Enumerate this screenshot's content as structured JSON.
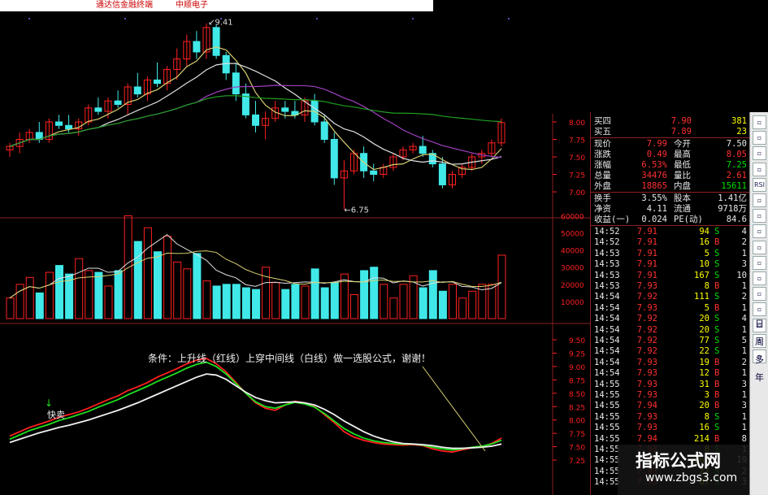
{
  "window": {
    "title_left": "通达信金融终端",
    "title_right": "中顺电子"
  },
  "chart_data": [
    {
      "type": "candlestick",
      "axis_ticks": [
        "8.00",
        "7.75",
        "7.50",
        "7.25",
        "7.00"
      ],
      "annotations": {
        "high": "9.41",
        "low": "6.75"
      },
      "candles": [
        [
          7.6,
          7.7,
          7.5,
          7.65
        ],
        [
          7.65,
          7.85,
          7.55,
          7.75
        ],
        [
          7.75,
          7.9,
          7.7,
          7.85
        ],
        [
          7.85,
          8.0,
          7.7,
          7.75
        ],
        [
          7.75,
          8.05,
          7.7,
          8.0
        ],
        [
          8.0,
          8.1,
          7.9,
          7.95
        ],
        [
          7.95,
          8.1,
          7.85,
          7.9
        ],
        [
          7.9,
          8.05,
          7.8,
          8.0
        ],
        [
          8.0,
          8.25,
          7.95,
          8.2
        ],
        [
          8.2,
          8.35,
          8.1,
          8.15
        ],
        [
          8.15,
          8.35,
          8.05,
          8.3
        ],
        [
          8.3,
          8.45,
          8.2,
          8.25
        ],
        [
          8.25,
          8.55,
          8.1,
          8.5
        ],
        [
          8.5,
          8.7,
          8.35,
          8.4
        ],
        [
          8.4,
          8.65,
          8.3,
          8.6
        ],
        [
          8.6,
          8.85,
          8.5,
          8.55
        ],
        [
          8.55,
          8.8,
          8.45,
          8.75
        ],
        [
          8.75,
          9.05,
          8.6,
          8.9
        ],
        [
          8.9,
          9.25,
          8.8,
          9.15
        ],
        [
          9.15,
          9.3,
          8.9,
          9.0
        ],
        [
          9.0,
          9.41,
          8.9,
          9.35
        ],
        [
          9.35,
          9.4,
          8.9,
          8.95
        ],
        [
          8.95,
          9.0,
          8.6,
          8.7
        ],
        [
          8.7,
          8.85,
          8.3,
          8.4
        ],
        [
          8.4,
          8.55,
          8.05,
          8.1
        ],
        [
          8.1,
          8.3,
          7.85,
          7.95
        ],
        [
          7.95,
          8.15,
          7.75,
          8.05
        ],
        [
          8.05,
          8.3,
          8.0,
          8.2
        ],
        [
          8.2,
          8.3,
          8.05,
          8.15
        ],
        [
          8.15,
          8.3,
          8.05,
          8.1
        ],
        [
          8.1,
          8.35,
          8.0,
          8.3
        ],
        [
          8.3,
          8.4,
          7.95,
          8.0
        ],
        [
          8.0,
          8.1,
          7.7,
          7.75
        ],
        [
          7.75,
          7.85,
          7.1,
          7.2
        ],
        [
          7.2,
          7.45,
          6.75,
          7.3
        ],
        [
          7.3,
          7.6,
          7.25,
          7.55
        ],
        [
          7.55,
          7.65,
          7.2,
          7.3
        ],
        [
          7.3,
          7.4,
          7.15,
          7.25
        ],
        [
          7.25,
          7.4,
          7.2,
          7.35
        ],
        [
          7.35,
          7.55,
          7.3,
          7.5
        ],
        [
          7.5,
          7.65,
          7.45,
          7.6
        ],
        [
          7.6,
          7.7,
          7.55,
          7.65
        ],
        [
          7.65,
          7.8,
          7.5,
          7.55
        ],
        [
          7.55,
          7.6,
          7.35,
          7.4
        ],
        [
          7.4,
          7.5,
          7.05,
          7.1
        ],
        [
          7.1,
          7.3,
          7.05,
          7.25
        ],
        [
          7.25,
          7.4,
          7.2,
          7.35
        ],
        [
          7.35,
          7.55,
          7.3,
          7.5
        ],
        [
          7.5,
          7.6,
          7.4,
          7.55
        ],
        [
          7.55,
          7.75,
          7.5,
          7.7
        ],
        [
          7.7,
          8.05,
          7.65,
          7.99
        ]
      ]
    },
    {
      "type": "bar",
      "axis_ticks": [
        "60000",
        "50000",
        "40000",
        "30000",
        "20000",
        "10000"
      ],
      "values": [
        12000,
        20000,
        24000,
        15000,
        27000,
        31000,
        26000,
        35000,
        28000,
        27000,
        19000,
        28000,
        60000,
        45000,
        53000,
        39000,
        48000,
        33000,
        29000,
        38000,
        22000,
        19000,
        20000,
        20000,
        18000,
        17000,
        30000,
        21000,
        17000,
        20000,
        19000,
        29000,
        18000,
        21000,
        26000,
        14000,
        28000,
        30000,
        20000,
        12000,
        20000,
        25000,
        18000,
        28000,
        16000,
        20000,
        12000,
        16000,
        20000,
        20000,
        37000
      ]
    },
    {
      "type": "line",
      "axis_ticks": [
        "9.50",
        "9.25",
        "9.00",
        "8.75",
        "8.50",
        "8.25",
        "8.00",
        "7.75",
        "7.50",
        "7.25"
      ],
      "series": [
        {
          "name": "",
          "color": "#ff2020",
          "values": [
            7.7,
            7.78,
            7.86,
            7.92,
            7.98,
            8.05,
            8.1,
            8.15,
            8.22,
            8.3,
            8.38,
            8.45,
            8.55,
            8.62,
            8.7,
            8.8,
            8.88,
            8.96,
            9.05,
            9.12,
            9.15,
            9.05,
            8.9,
            8.7,
            8.5,
            8.32,
            8.22,
            8.18,
            8.28,
            8.35,
            8.32,
            8.25,
            8.1,
            7.95,
            7.78,
            7.68,
            7.62,
            7.58,
            7.55,
            7.54,
            7.53,
            7.54,
            7.52,
            7.46,
            7.42,
            7.4,
            7.44,
            7.48,
            7.5,
            7.56,
            7.66
          ]
        },
        {
          "name": "",
          "color": "#20e020",
          "values": [
            7.64,
            7.72,
            7.8,
            7.86,
            7.92,
            7.99,
            8.04,
            8.1,
            8.16,
            8.24,
            8.31,
            8.38,
            8.47,
            8.55,
            8.63,
            8.72,
            8.8,
            8.88,
            8.97,
            9.04,
            9.08,
            9.0,
            8.86,
            8.68,
            8.5,
            8.34,
            8.25,
            8.22,
            8.28,
            8.33,
            8.3,
            8.24,
            8.12,
            7.98,
            7.84,
            7.74,
            7.66,
            7.61,
            7.58,
            7.56,
            7.55,
            7.55,
            7.53,
            7.49,
            7.46,
            7.44,
            7.46,
            7.49,
            7.51,
            7.55,
            7.62
          ]
        },
        {
          "name": "",
          "color": "#f0f0f0",
          "values": [
            7.58,
            7.64,
            7.7,
            7.76,
            7.81,
            7.86,
            7.9,
            7.95,
            8.0,
            8.06,
            8.12,
            8.18,
            8.25,
            8.32,
            8.4,
            8.48,
            8.56,
            8.64,
            8.72,
            8.8,
            8.86,
            8.84,
            8.76,
            8.64,
            8.52,
            8.42,
            8.36,
            8.32,
            8.33,
            8.34,
            8.32,
            8.28,
            8.2,
            8.1,
            7.98,
            7.88,
            7.78,
            7.7,
            7.64,
            7.59,
            7.56,
            7.55,
            7.54,
            7.52,
            7.49,
            7.47,
            7.47,
            7.48,
            7.49,
            7.51,
            7.55
          ]
        }
      ],
      "signal_label": "快卖"
    }
  ],
  "note": "条件：上升线（红线）上穿中间线（白线）做一选股公式，谢谢！",
  "quote": {
    "asks": [
      {
        "label": "买四",
        "price": "7.90",
        "vol": "381"
      },
      {
        "label": "买五",
        "price": "7.89",
        "vol": "23"
      }
    ],
    "stats": [
      [
        "现价",
        "7.99",
        "今开",
        "7.50"
      ],
      [
        "涨跌",
        "0.49",
        "最高",
        "8.05"
      ],
      [
        "涨幅",
        "6.53%",
        "最低",
        "7.25"
      ],
      [
        "总量",
        "34476",
        "量比",
        "2.61"
      ],
      [
        "外盘",
        "18865",
        "内盘",
        "15611"
      ]
    ],
    "fund": [
      [
        "换手",
        "3.55%",
        "股本",
        "1.41亿"
      ],
      [
        "净资",
        "4.11",
        "流通",
        "9718万"
      ],
      [
        "收益(一)",
        "0.024",
        "PE(动)",
        "84.6"
      ]
    ],
    "ticks": [
      [
        "14:52",
        "7.91",
        "94",
        "S",
        "4"
      ],
      [
        "14:52",
        "7.91",
        "16",
        "B",
        "2"
      ],
      [
        "14:53",
        "7.91",
        "5",
        "S",
        "1"
      ],
      [
        "14:53",
        "7.91",
        "10",
        "S",
        "3"
      ],
      [
        "14:53",
        "7.91",
        "167",
        "S",
        "10"
      ],
      [
        "14:53",
        "7.93",
        "8",
        "B",
        "1"
      ],
      [
        "14:54",
        "7.92",
        "111",
        "S",
        "2"
      ],
      [
        "14:54",
        "7.93",
        "5",
        "B",
        "1"
      ],
      [
        "14:54",
        "7.92",
        "20",
        "S",
        "4"
      ],
      [
        "14:54",
        "7.92",
        "20",
        "S",
        "1"
      ],
      [
        "14:54",
        "7.92",
        "77",
        "S",
        "5"
      ],
      [
        "14:54",
        "7.92",
        "22",
        "S",
        "1"
      ],
      [
        "14:54",
        "7.93",
        "19",
        "B",
        "2"
      ],
      [
        "14:54",
        "7.93",
        "12",
        "B",
        "1"
      ],
      [
        "14:55",
        "7.93",
        "31",
        "B",
        "3"
      ],
      [
        "14:55",
        "7.93",
        "3",
        "B",
        "1"
      ],
      [
        "14:55",
        "7.94",
        "20",
        "B",
        "3"
      ],
      [
        "14:55",
        "7.93",
        "8",
        "S",
        "1"
      ],
      [
        "14:55",
        "7.93",
        "16",
        "S",
        "1"
      ],
      [
        "14:55",
        "7.94",
        "214",
        "B",
        "8"
      ],
      [
        "14:55",
        "7.93",
        "8",
        "S",
        "1"
      ],
      [
        "14:55",
        "7.95",
        "263",
        "B",
        "19"
      ],
      [
        "14:55",
        "7.93",
        "22",
        "S",
        "2"
      ],
      [
        "14:55",
        "7.93",
        "67",
        "S",
        "3"
      ]
    ]
  },
  "toolbar": {
    "labels": [
      "日",
      "周",
      "多",
      "年"
    ]
  },
  "watermark": {
    "line1": "指标公式网",
    "line2": "www.zbgs3.com"
  },
  "colors": {
    "up": "#ff2020",
    "down": "#40e8e8",
    "grid": "#8a2020",
    "ma_yellow": "#d8d070",
    "ma_purple": "#a040c0",
    "ma_green": "#20a020"
  }
}
